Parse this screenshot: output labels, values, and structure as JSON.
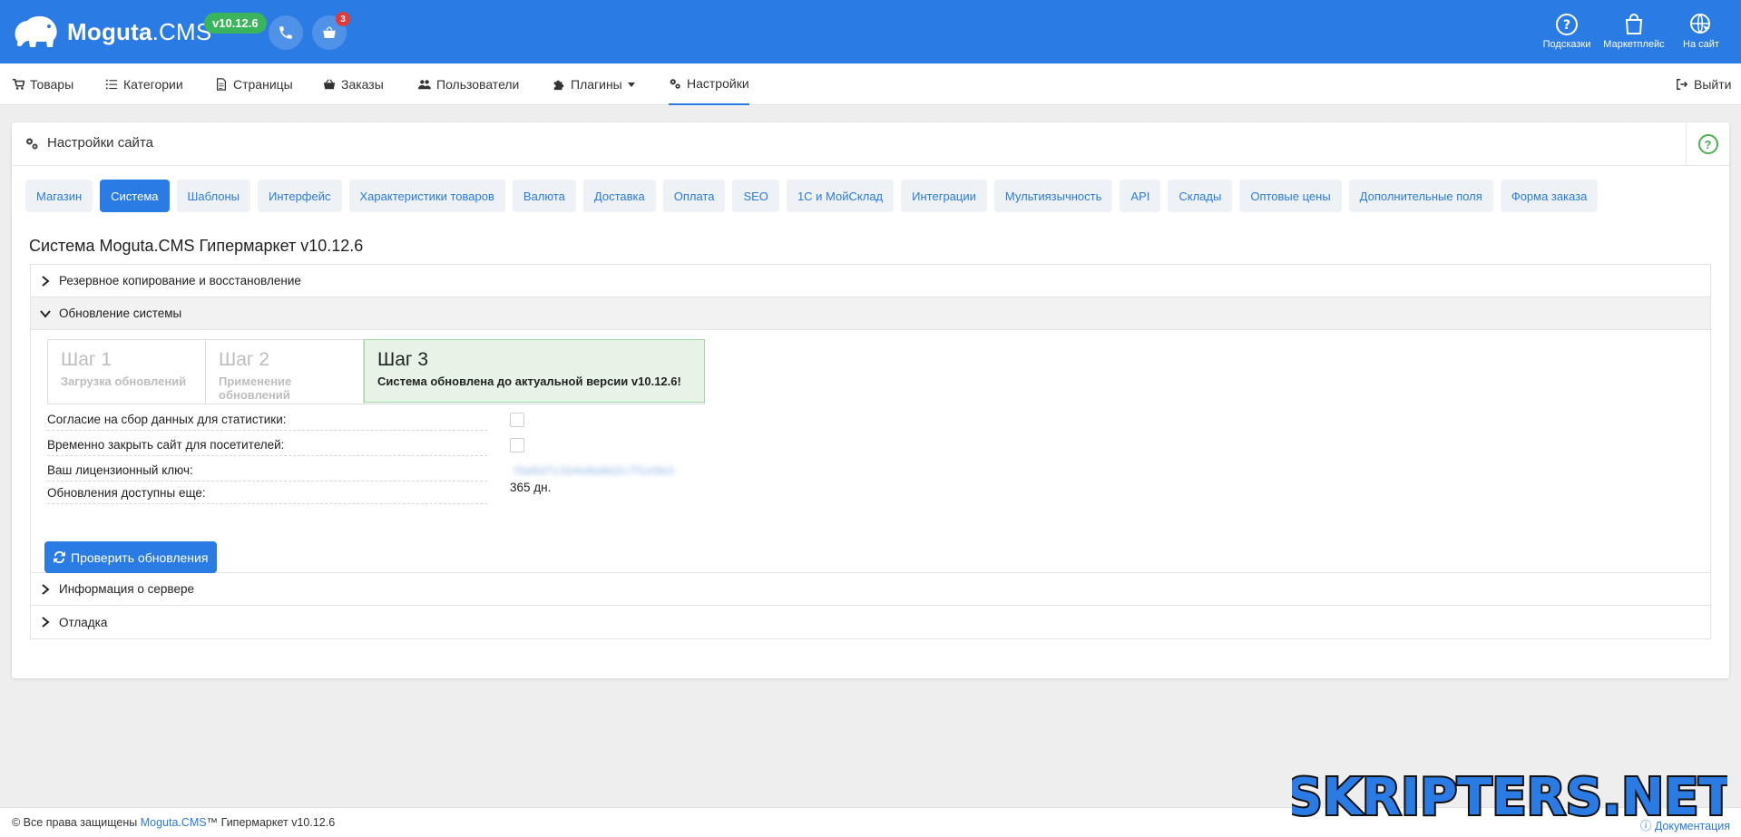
{
  "topbar": {
    "brand_bold": "Moguta",
    "brand_light": ".CMS",
    "version": "v10.12.6",
    "cart_badge": "3",
    "links": [
      {
        "label": "Подсказки"
      },
      {
        "label": "Маркетплейс"
      },
      {
        "label": "На сайт"
      }
    ]
  },
  "nav": {
    "items": [
      {
        "label": "Товары"
      },
      {
        "label": "Категории"
      },
      {
        "label": "Страницы"
      },
      {
        "label": "Заказы"
      },
      {
        "label": "Пользователи"
      },
      {
        "label": "Плагины"
      },
      {
        "label": "Настройки"
      }
    ],
    "logout": "Выйти"
  },
  "panel": {
    "title": "Настройки сайта",
    "help": "?",
    "tabs": [
      "Магазин",
      "Система",
      "Шаблоны",
      "Интерфейс",
      "Характеристики товаров",
      "Валюта",
      "Доставка",
      "Оплата",
      "SEO",
      "1С и МойСклад",
      "Интеграции",
      "Мультиязычность",
      "API",
      "Склады",
      "Оптовые цены",
      "Дополнительные поля",
      "Форма заказа"
    ],
    "active_tab": "Система",
    "section_title": "Система Moguta.CMS Гипермаркет v10.12.6",
    "accordion": {
      "backup": "Резервное копирование и восстановление",
      "update": "Обновление системы",
      "server": "Информация о сервере",
      "debug": "Отладка"
    },
    "steps": [
      {
        "title": "Шаг 1",
        "sub": "Загрузка обновлений"
      },
      {
        "title": "Шаг 2",
        "sub": "Применение обновлений"
      },
      {
        "title": "Шаг 3",
        "sub": "Система обновлена до актуальной версии v10.12.6!"
      }
    ],
    "form": {
      "stats_label": "Согласие на сбор данных для статистики:",
      "stats_checked": false,
      "close_label": "Временно закрыть сайт для посетителей:",
      "close_checked": false,
      "license_label": "Ваш лицензионный ключ:",
      "license_value": "f3a6d7c1b4e8a9d2c7f1e5b3",
      "updates_label": "Обновления доступны еще:",
      "updates_value": "365 дн."
    },
    "check_button": "Проверить обновления"
  },
  "footer": {
    "copyright": "© Все права защищены ",
    "brand": "Moguta.CMS",
    "tm": "™ Гипермаркет v10.12.6",
    "docs": "Документация"
  },
  "watermark": "SKRIPTERS.NET",
  "colors": {
    "brand_blue": "#2b7be4",
    "version_green": "#3bb55b",
    "badge_red": "#e53935",
    "step_done_bg": "#e6f3e6"
  }
}
